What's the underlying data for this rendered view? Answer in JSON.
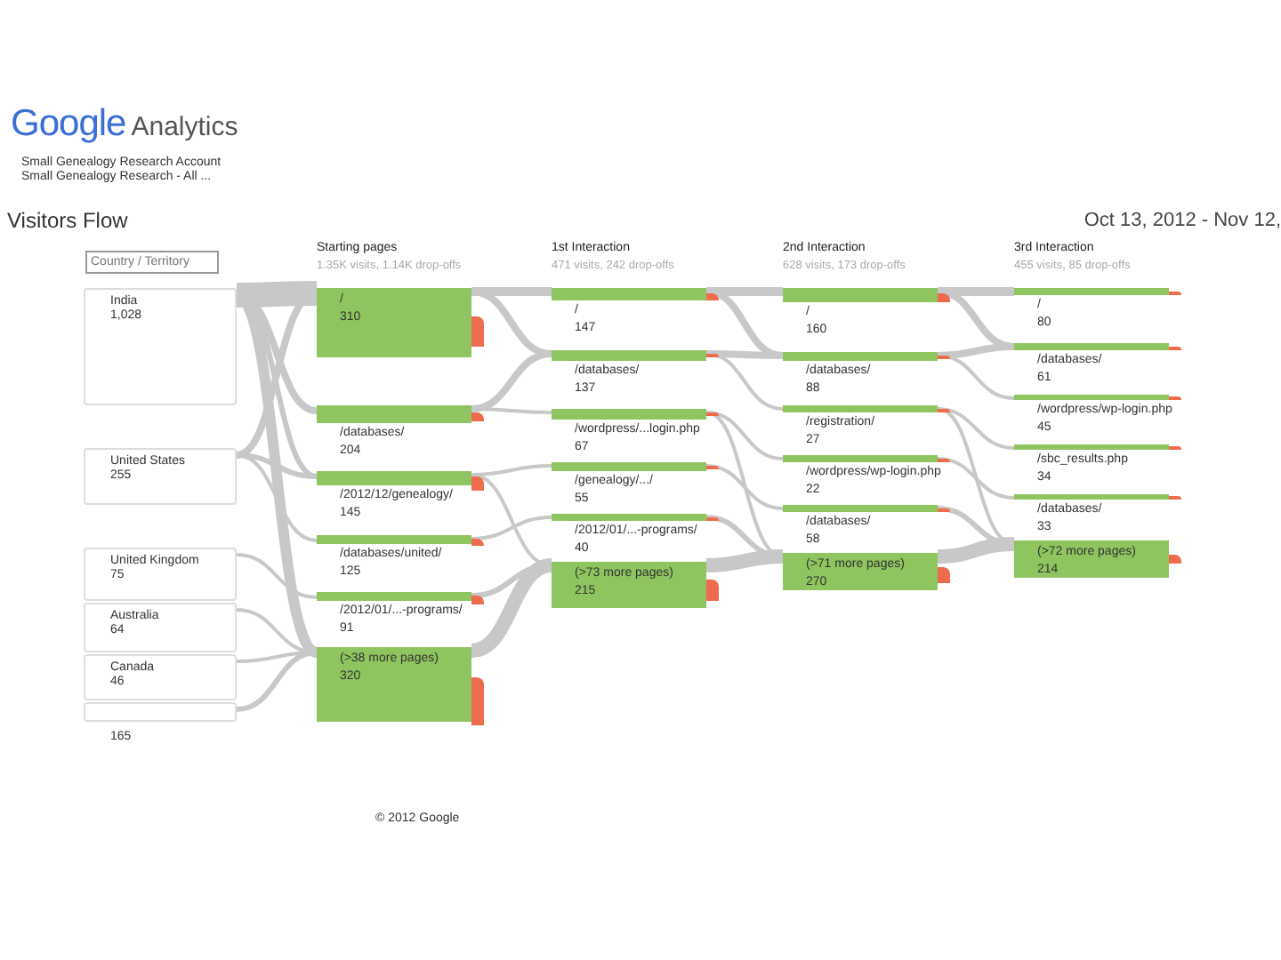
{
  "header": {
    "brand": "Google",
    "product": "Analytics",
    "account": "Small Genealogy Research Account",
    "profile": "Small Genealogy Research - All ..."
  },
  "title": "Visitors Flow",
  "date_range": "Oct 13, 2012 - Nov 12,",
  "dimension_select": {
    "value": "Country / Territory"
  },
  "countries": [
    {
      "name": "India",
      "count": "1,028"
    },
    {
      "name": "United States",
      "count": "255"
    },
    {
      "name": "United Kingdom",
      "count": "75"
    },
    {
      "name": "Australia",
      "count": "64"
    },
    {
      "name": "Canada",
      "count": "46"
    },
    {
      "count": "165"
    }
  ],
  "steps": [
    {
      "title": "Starting pages",
      "summary": "1.35K visits, 1.14K drop-offs",
      "nodes": [
        {
          "label": "/",
          "count": "310"
        },
        {
          "label": "/databases/",
          "count": "204"
        },
        {
          "label": "/2012/12/genealogy/",
          "count": "145"
        },
        {
          "label": "/databases/united/",
          "count": "125"
        },
        {
          "label": "/2012/01/...-programs/",
          "count": "91"
        },
        {
          "label": "(>38 more pages)",
          "count": "320"
        }
      ]
    },
    {
      "title": "1st Interaction",
      "summary": "471 visits, 242 drop-offs",
      "nodes": [
        {
          "label": "/",
          "count": "147"
        },
        {
          "label": "/databases/",
          "count": "137"
        },
        {
          "label": "/wordpress/...login.php",
          "count": "67"
        },
        {
          "label": "/genealogy/.../",
          "count": "55"
        },
        {
          "label": "/2012/01/...-programs/",
          "count": "40"
        },
        {
          "label": "(>73 more pages)",
          "count": "215"
        }
      ]
    },
    {
      "title": "2nd Interaction",
      "summary": "628 visits, 173 drop-offs",
      "nodes": [
        {
          "label": "/",
          "count": "160"
        },
        {
          "label": "/databases/",
          "count": "88"
        },
        {
          "label": "/registration/",
          "count": "27"
        },
        {
          "label": "/wordpress/wp-login.php",
          "count": "22"
        },
        {
          "label": "/databases/",
          "count": "58"
        },
        {
          "label": "(>71 more pages)",
          "count": "270"
        }
      ]
    },
    {
      "title": "3rd Interaction",
      "summary": "455 visits, 85 drop-offs",
      "nodes": [
        {
          "label": "/",
          "count": "80"
        },
        {
          "label": "/databases/",
          "count": "61"
        },
        {
          "label": "/wordpress/wp-login.php",
          "count": "45"
        },
        {
          "label": "/sbc_results.php",
          "count": "34"
        },
        {
          "label": "/databases/",
          "count": "33"
        },
        {
          "label": "(>72 more pages)",
          "count": "214"
        }
      ]
    }
  ],
  "footer": "© 2012 Google"
}
